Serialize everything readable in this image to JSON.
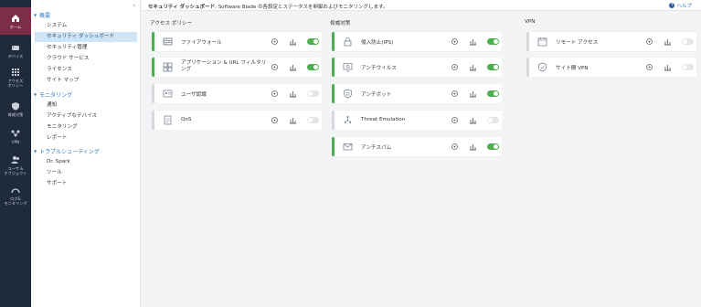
{
  "rail": [
    {
      "icon": "home-icon",
      "label": "ホーム"
    },
    {
      "icon": "devices-icon",
      "label": "デバイス"
    },
    {
      "icon": "access-policy-icon",
      "label": "アクセス\nポリシー"
    },
    {
      "icon": "threat-prevention-icon",
      "label": "脅威対策"
    },
    {
      "icon": "vpn-icon",
      "label": "VPN"
    },
    {
      "icon": "users-objects-icon",
      "label": "ユーザ &\nオブジェクト"
    },
    {
      "icon": "logs-monitoring-icon",
      "label": "ログ&\nモニタリング"
    }
  ],
  "tree": {
    "groups": {
      "overview": "概要",
      "monitoring": "モニタリング",
      "troubleshooting": "トラブルシューティング"
    },
    "overview_items": [
      "システム",
      "セキュリティ ダッシュボード",
      "セキュリティ管理",
      "クラウド サービス",
      "ライセンス",
      "サイト マップ"
    ],
    "monitoring_items": [
      "通知",
      "アクティブなデバイス",
      "モニタリング",
      "レポート"
    ],
    "troubleshooting_items": [
      "Dr. Spark",
      "ツール",
      "サポート"
    ]
  },
  "header": {
    "title": "セキュリティ ダッシュボード",
    "description": ": Software Blade の各設定とステータスを制御およびモニタリングします。",
    "help": "ヘルプ"
  },
  "columns": {
    "access": {
      "title": "アクセス ポリシー",
      "cards": [
        {
          "label": "ファイアウォール",
          "enabled": true
        },
        {
          "label": "アプリケーション & URL フィルタリング",
          "enabled": true
        },
        {
          "label": "ユーザ認識",
          "enabled": false
        },
        {
          "label": "QoS",
          "enabled": false
        }
      ]
    },
    "threat": {
      "title": "脅威対策",
      "cards": [
        {
          "label": "侵入防止(IPS)",
          "enabled": true
        },
        {
          "label": "アンチウイルス",
          "enabled": true
        },
        {
          "label": "アンチボット",
          "enabled": true
        },
        {
          "label": "Threat Emulation",
          "enabled": false
        },
        {
          "label": "アンチスパム",
          "enabled": true
        }
      ]
    },
    "vpn": {
      "title": "VPN",
      "cards": [
        {
          "label": "リモート アクセス",
          "enabled": false
        },
        {
          "label": "サイト間 VPN",
          "enabled": false
        }
      ]
    }
  },
  "colors": {
    "rail_bg": "#1f2a3a",
    "rail_active": "#7b2d4a",
    "accent_blue": "#2d7bc4",
    "enabled_green": "#4caf50",
    "disabled_gray": "#d5d8dc"
  }
}
